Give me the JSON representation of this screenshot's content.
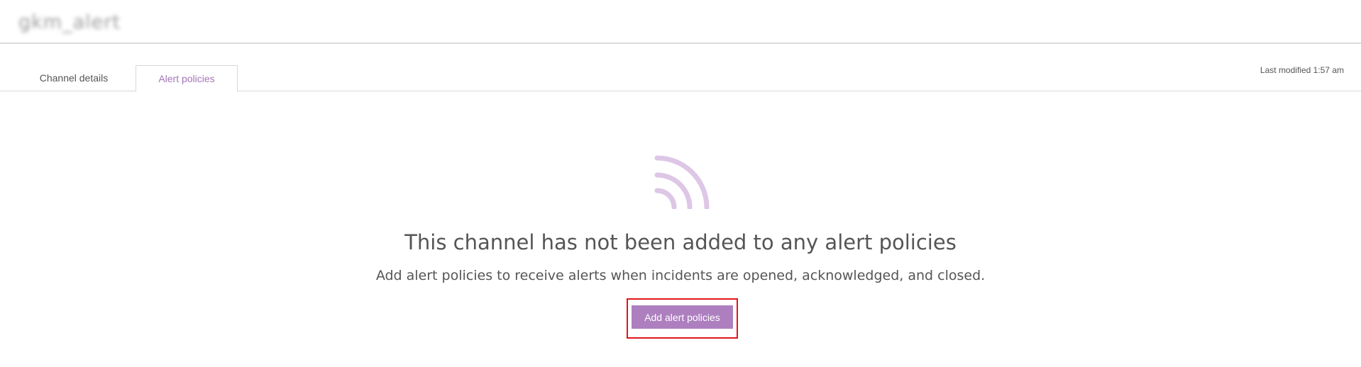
{
  "header": {
    "channel_name": "gkm_alert"
  },
  "tabs": [
    {
      "label": "Channel details",
      "active": false
    },
    {
      "label": "Alert policies",
      "active": true
    }
  ],
  "last_modified": "Last modified 1:57 am",
  "empty_state": {
    "icon": "signal-icon",
    "title": "This channel has not been added to any alert policies",
    "subtitle": "Add alert policies to receive alerts when incidents are opened, acknowledged, and closed.",
    "button_label": "Add alert policies"
  },
  "colors": {
    "accent": "#ad7fbf",
    "accent_light": "#ddc6e6",
    "active_tab_text": "#a476b8",
    "highlight_border": "#e0161b"
  }
}
